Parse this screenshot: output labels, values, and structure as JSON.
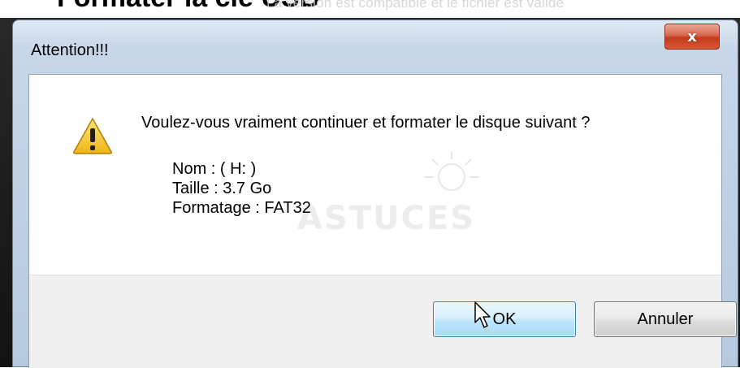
{
  "background": {
    "heading": "Formater la clé USB",
    "status_text": "La version est compatible et le fichier est valide"
  },
  "dialog": {
    "title": "Attention!!!",
    "close_glyph": "x",
    "icon": "warning-icon",
    "question": "Voulez-vous vraiment continuer et formater le disque suivant ?",
    "details": {
      "name": "Nom : ( H: )",
      "size": "Taille : 3.7 Go",
      "format": "Formatage : FAT32"
    },
    "watermark": "ASTUCES",
    "buttons": {
      "ok": "OK",
      "cancel": "Annuler"
    }
  },
  "colors": {
    "frame": "#c7d7e9",
    "close_button": "#c43b1e",
    "ok_button_border": "#3c7fb1",
    "warning_yellow": "#f4c21b"
  }
}
